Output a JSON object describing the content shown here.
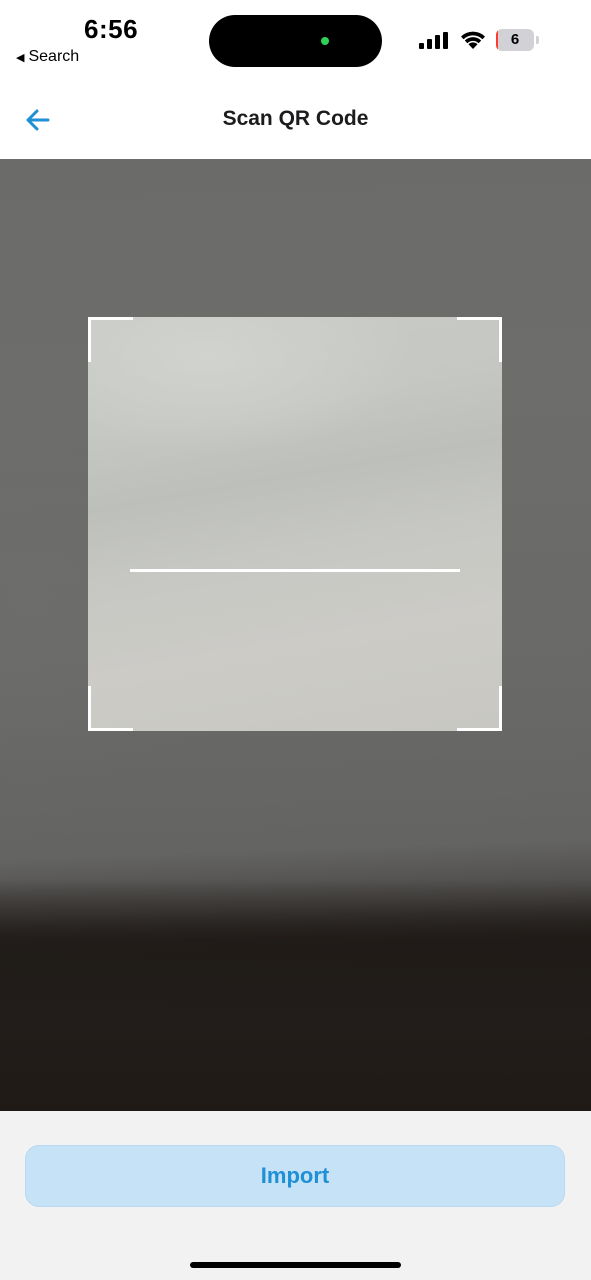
{
  "status_bar": {
    "time": "6:56",
    "back_app_label": "Search",
    "back_app_icon": "triangle-left-icon",
    "signal_icon": "cellular-signal-icon",
    "wifi_icon": "wifi-icon",
    "battery_level": "6",
    "battery_fill_percent": 6,
    "battery_color": "#ff3b30",
    "camera_in_use_indicator_color": "#30d158"
  },
  "header": {
    "title": "Scan QR Code",
    "back_icon": "arrow-left-icon",
    "accent_color": "#1f8fd6"
  },
  "scanner": {
    "frame_icon": "qr-viewfinder",
    "scan_line_color": "#ffffff"
  },
  "footer": {
    "import_label": "Import",
    "import_button_color": "#c5e2f6",
    "import_text_color": "#1f8fd6"
  }
}
